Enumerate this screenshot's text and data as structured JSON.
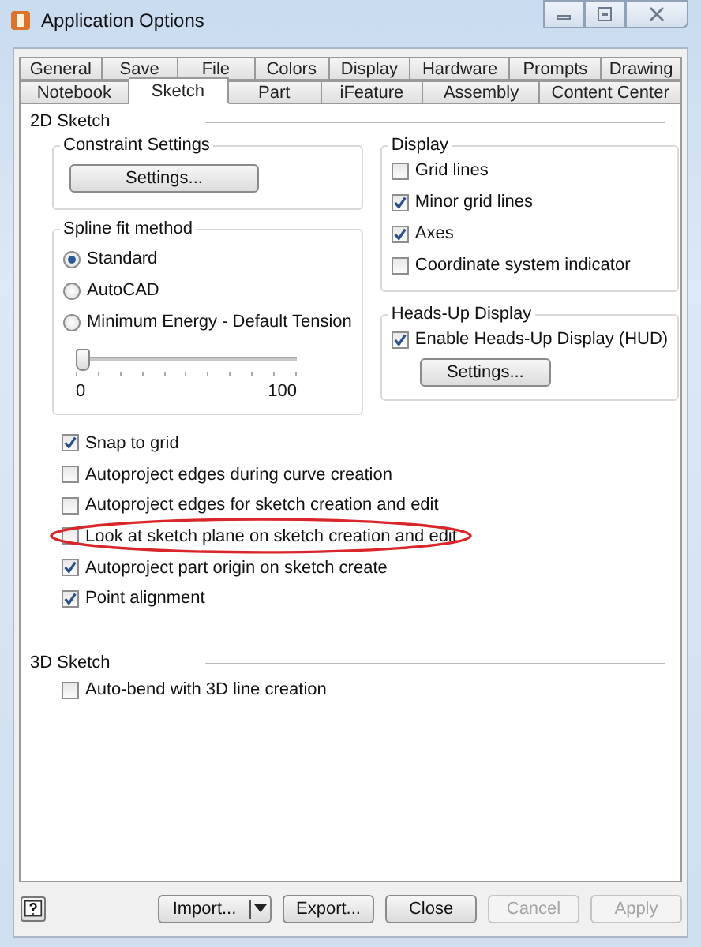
{
  "window": {
    "title": "Application Options"
  },
  "tab_rows": [
    {
      "tabs": [
        {
          "label": "General",
          "selected": false
        },
        {
          "label": "Save",
          "selected": false
        },
        {
          "label": "File",
          "selected": false
        },
        {
          "label": "Colors",
          "selected": false
        },
        {
          "label": "Display",
          "selected": false
        },
        {
          "label": "Hardware",
          "selected": false
        },
        {
          "label": "Prompts",
          "selected": false
        },
        {
          "label": "Drawing",
          "selected": false
        }
      ]
    },
    {
      "tabs": [
        {
          "label": "Notebook",
          "selected": false
        },
        {
          "label": "Sketch",
          "selected": true
        },
        {
          "label": "Part",
          "selected": false
        },
        {
          "label": "iFeature",
          "selected": false
        },
        {
          "label": "Assembly",
          "selected": false
        },
        {
          "label": "Content Center",
          "selected": false
        }
      ]
    }
  ],
  "sketch_2d": {
    "heading": "2D Sketch",
    "constraint_settings": {
      "title": "Constraint Settings",
      "button": "Settings..."
    },
    "spline_fit_method": {
      "title": "Spline fit method",
      "options": [
        {
          "label": "Standard",
          "selected": true
        },
        {
          "label": "AutoCAD",
          "selected": false
        },
        {
          "label": "Minimum Energy - Default Tension",
          "selected": false
        }
      ],
      "slider": {
        "level": 0,
        "min_label": "0",
        "max_label": "100"
      }
    },
    "display": {
      "title": "Display",
      "options": [
        {
          "label": "Grid lines",
          "checked": false
        },
        {
          "label": "Minor grid lines",
          "checked": true
        },
        {
          "label": "Axes",
          "checked": true
        },
        {
          "label": "Coordinate system indicator",
          "checked": false
        }
      ]
    },
    "heads_up_display": {
      "title": "Heads-Up Display",
      "option": {
        "label": "Enable Heads-Up Display (HUD)",
        "checked": true
      },
      "button": "Settings..."
    },
    "options": [
      {
        "label": "Snap to grid",
        "checked": true,
        "circled": false
      },
      {
        "label": "Autoproject edges during curve creation",
        "checked": false,
        "circled": false
      },
      {
        "label": "Autoproject edges for sketch creation and edit",
        "checked": false,
        "circled": false
      },
      {
        "label": "Look at sketch plane on sketch creation and edit",
        "checked": false,
        "circled": true
      },
      {
        "label": "Autoproject part origin on sketch create",
        "checked": true,
        "circled": false
      },
      {
        "label": "Point alignment",
        "checked": true,
        "circled": false
      }
    ]
  },
  "sketch_3d": {
    "heading": "3D Sketch",
    "options": [
      {
        "label": "Auto-bend with 3D line creation",
        "checked": false
      }
    ]
  },
  "buttons": [
    {
      "label": "Import...",
      "kind": "split",
      "disabled": false
    },
    {
      "label": "Export...",
      "kind": "plain",
      "disabled": false
    },
    {
      "label": "Close",
      "kind": "plain",
      "disabled": false
    },
    {
      "label": "Cancel",
      "kind": "plain",
      "disabled": true
    },
    {
      "label": "Apply",
      "kind": "plain",
      "disabled": true
    }
  ]
}
